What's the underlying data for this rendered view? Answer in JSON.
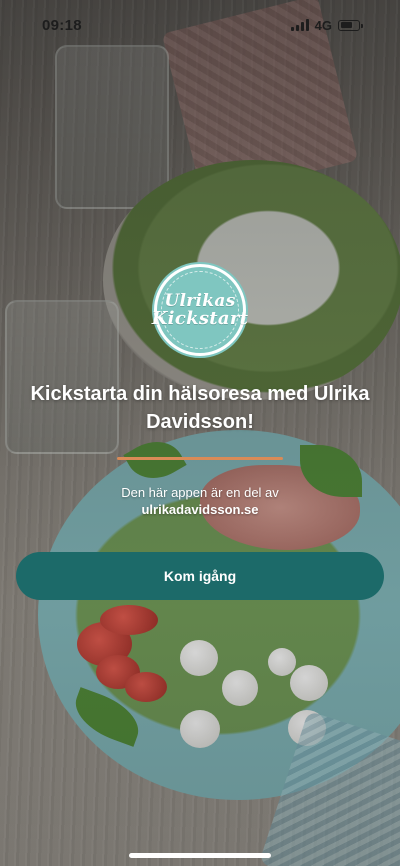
{
  "status_bar": {
    "time": "09:18",
    "network": "4G",
    "battery_level": 0.7
  },
  "logo": {
    "line1": "Ulrikas",
    "line2": "Kickstart"
  },
  "headline": "Kickstarta din hälsoresa med Ulrika Davidsson!",
  "subtitle": "Den här appen är en del av",
  "site_link": "ulrikadavidsson.se",
  "cta_label": "Kom igång",
  "colors": {
    "accent_divider": "#d98b57",
    "button": "#1c6a69",
    "logo_badge": "#7fc6c0"
  },
  "icons": [
    "signal-icon",
    "battery-icon"
  ]
}
